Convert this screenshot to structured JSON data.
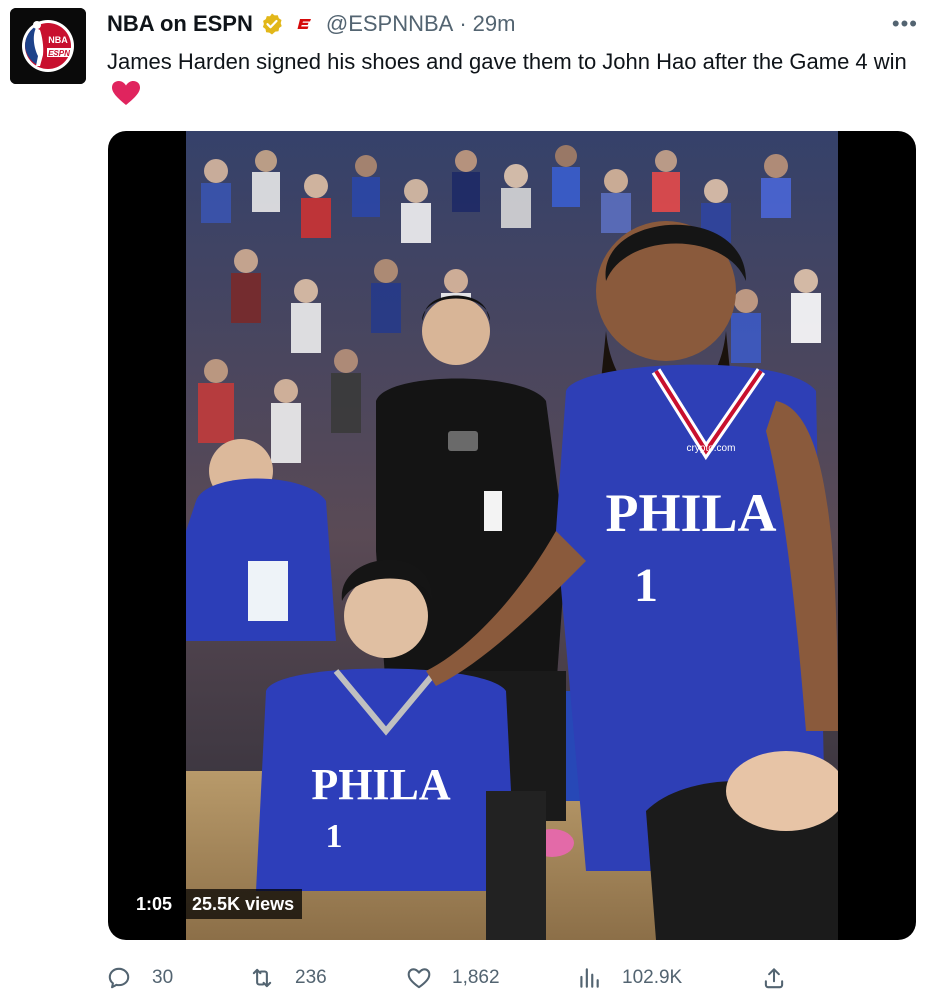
{
  "account": {
    "display_name": "NBA on ESPN",
    "handle": "@ESPNNBA",
    "separator": "·",
    "time_ago": "29m",
    "avatar_text_top": "NBA",
    "avatar_text_bottom": "ESPN"
  },
  "tweet": {
    "text": "James Harden signed his shoes and gave them to John Hao after the Game 4 win"
  },
  "media": {
    "duration": "1:05",
    "views": "25.5K views",
    "jersey_text": "PHILA",
    "jersey_number": "1",
    "sponsor_text": "crypto.com"
  },
  "actions": {
    "replies": "30",
    "retweets": "236",
    "likes": "1,862",
    "views": "102.9K"
  },
  "colors": {
    "accent_blue": "#1d9bf0",
    "verified_gold": "#e2b719",
    "espn_red": "#d50a0a",
    "heart_red": "#e0245e",
    "sixers_blue": "#2e3fb6"
  }
}
